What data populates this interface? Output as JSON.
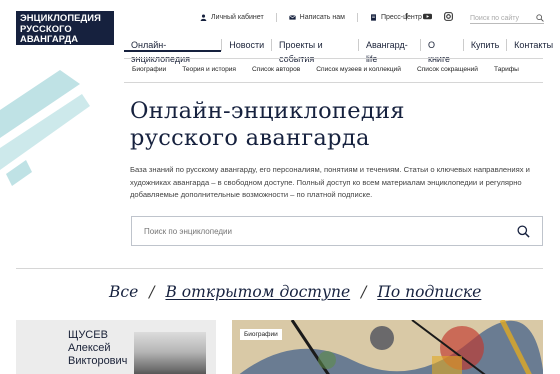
{
  "logo": {
    "lines": [
      "ЭНЦИКЛОПЕДИЯ",
      "РУССКОГО",
      "АВАНГАРДА"
    ]
  },
  "toplinks": [
    {
      "label": "Личный кабинет",
      "icon": "user-icon"
    },
    {
      "label": "Написать нам",
      "icon": "mail-icon"
    },
    {
      "label": "Пресс-центр",
      "icon": "document-icon"
    }
  ],
  "social": [
    "facebook-icon",
    "youtube-icon",
    "instagram-icon"
  ],
  "search_mini": {
    "placeholder": "Поиск по сайту"
  },
  "mainnav": [
    "Онлайн-энциклопедия",
    "Новости",
    "Проекты и события",
    "Авангард-life",
    "О книге",
    "Купить",
    "Контакты"
  ],
  "subnav": [
    "Биографии",
    "Теория и история",
    "Список авторов",
    "Список музеев и коллекций",
    "Список сокращений",
    "Тарифы"
  ],
  "hero": {
    "title_line1": "Онлайн-энциклопедия",
    "title_line2": "русского авангарда",
    "description": "База знаний по русскому авангарду, его персоналиям, понятиям и течениям. Статьи о ключевых направлениях и художниках авангарда – в свободном доступе. Полный доступ ко всем материалам энциклопедии и регулярно добавляемые дополнительные возможности – по платной подписке."
  },
  "search": {
    "placeholder": "Поиск по энциклопедии"
  },
  "filters": {
    "all": "Все",
    "open": "В открытом доступе",
    "subscription": "По подписке"
  },
  "cards": {
    "person": {
      "surname": "ЩУСЕВ",
      "first": "Алексей",
      "patronymic": "Викторович"
    },
    "artwork": {
      "badge": "Биографии"
    }
  },
  "colors": {
    "navy": "#16213e",
    "accent_teal": "#bfe2e5"
  }
}
